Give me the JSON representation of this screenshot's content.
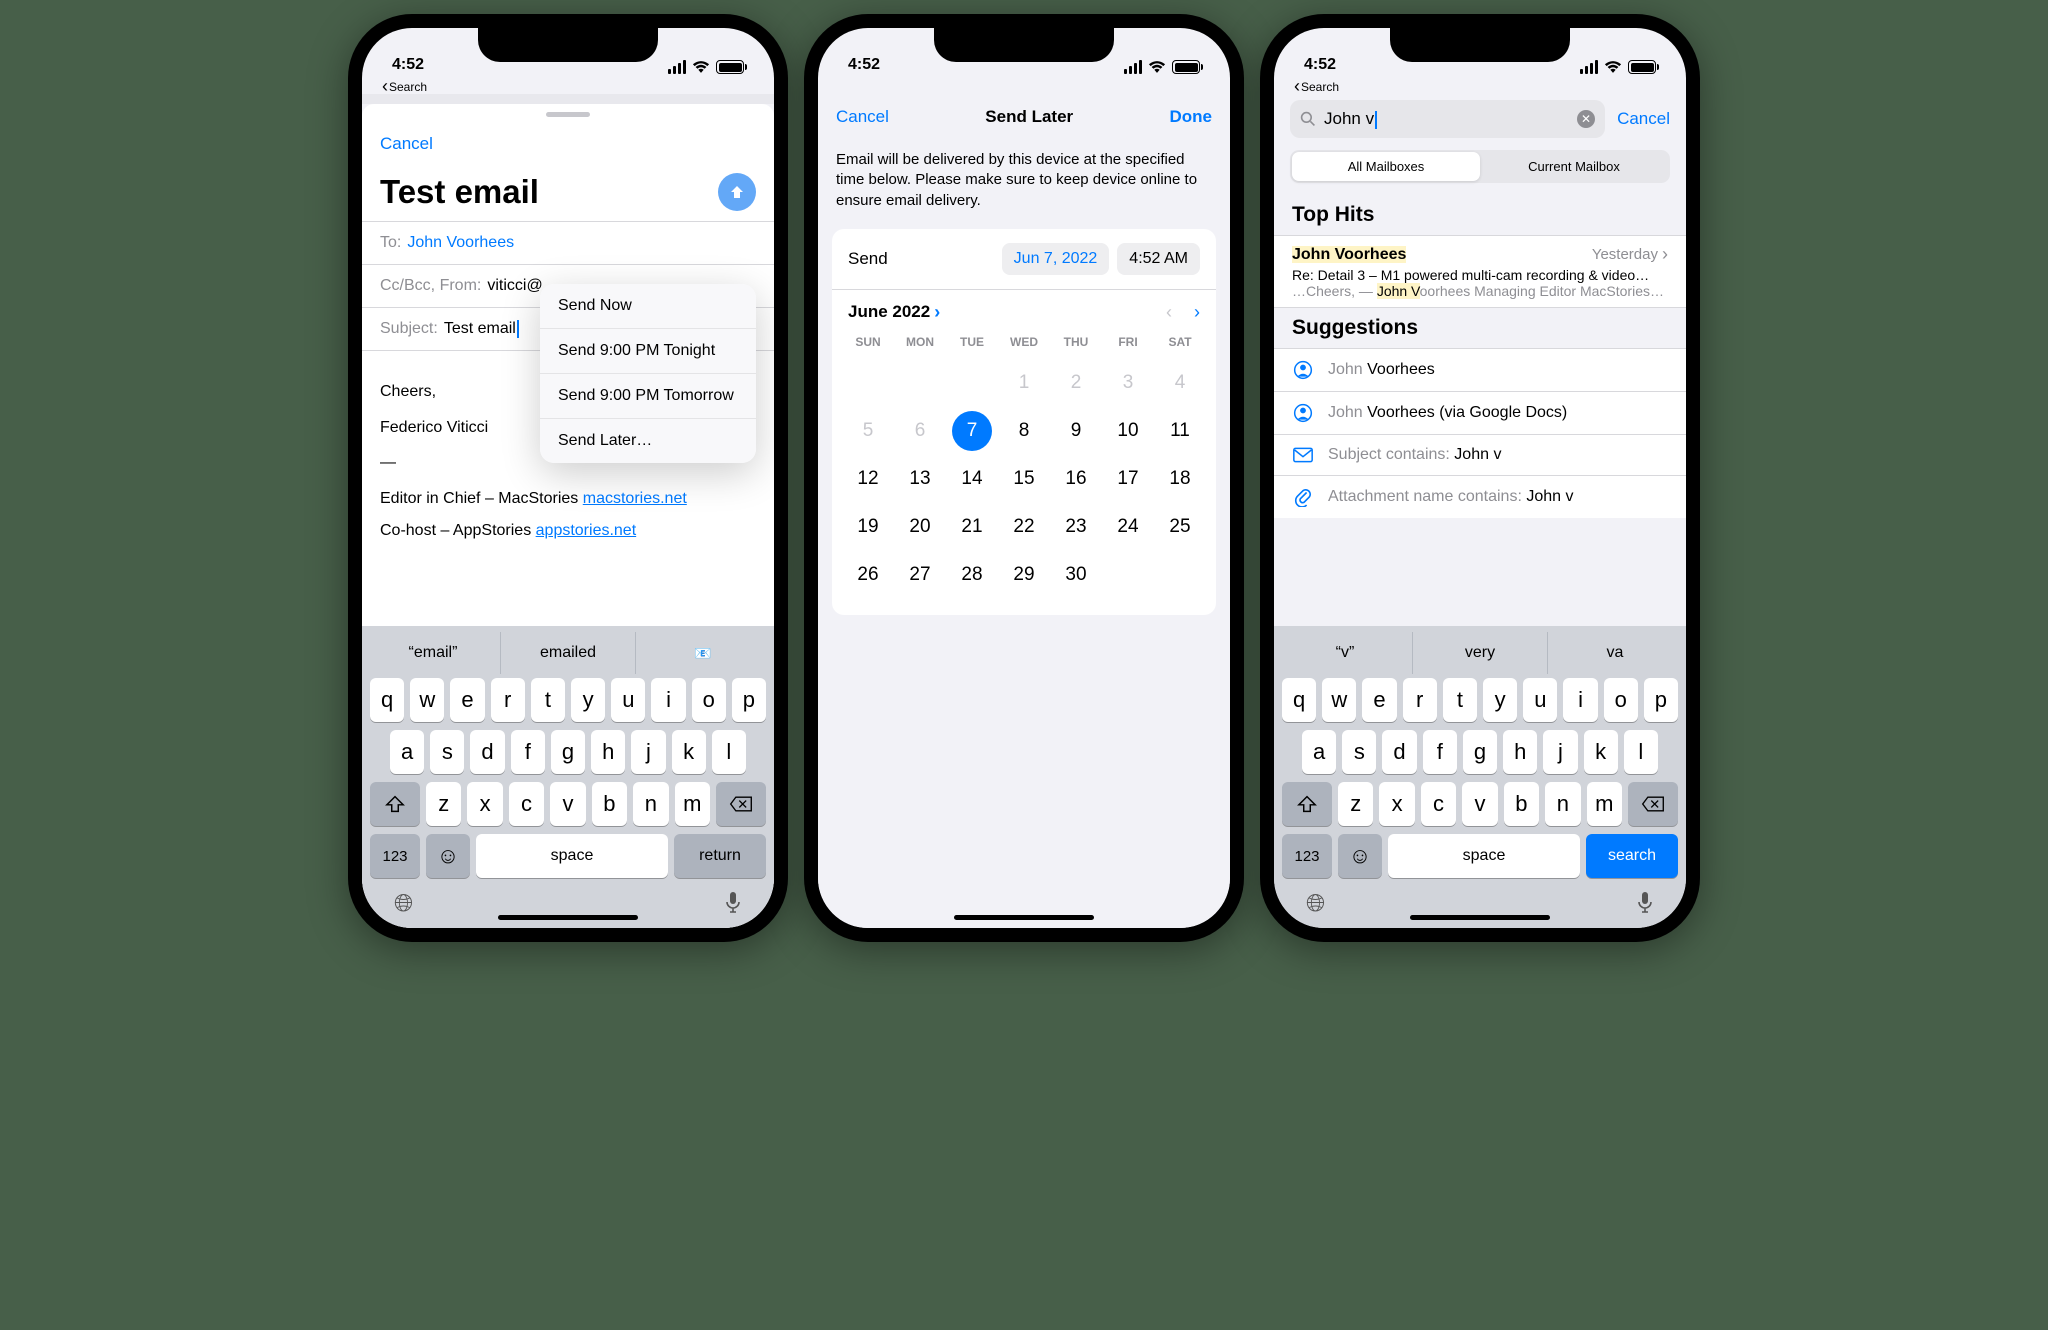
{
  "status": {
    "time": "4:52",
    "back_label": "Search"
  },
  "pane1": {
    "cancel": "Cancel",
    "title": "Test email",
    "to_label": "To:",
    "to_value": "John Voorhees",
    "cc_label": "Cc/Bcc, From:",
    "cc_value": "viticci@",
    "subject_label": "Subject:",
    "subject_value": "Test email",
    "menu": [
      "Send Now",
      "Send 9:00 PM Tonight",
      "Send 9:00 PM Tomorrow",
      "Send Later…"
    ],
    "body_cheers": "Cheers,",
    "body_name": "Federico Viticci",
    "body_dash": "—",
    "body_line1_pre": "Editor in Chief – MacStories ",
    "body_line1_link": "macstories.net",
    "body_line2_pre": "Co-host – AppStories ",
    "body_line2_link": "appstories.net",
    "sugg": [
      "“email”",
      "emailed",
      ""
    ],
    "return": "return",
    "space": "space",
    "num": "123"
  },
  "pane2": {
    "cancel": "Cancel",
    "title": "Send Later",
    "done": "Done",
    "desc": "Email will be delivered by this device at the specified time below. Please make sure to keep device online to ensure email delivery.",
    "send_label": "Send",
    "date_chip": "Jun 7, 2022",
    "time_chip": "4:52 AM",
    "month": "June 2022",
    "dow": [
      "SUN",
      "MON",
      "TUE",
      "WED",
      "THU",
      "FRI",
      "SAT"
    ],
    "days": [
      {
        "n": "",
        "t": "blank"
      },
      {
        "n": "",
        "t": "blank"
      },
      {
        "n": "",
        "t": "blank"
      },
      {
        "n": "1",
        "t": "dim"
      },
      {
        "n": "2",
        "t": "dim"
      },
      {
        "n": "3",
        "t": "dim"
      },
      {
        "n": "4",
        "t": "dim"
      },
      {
        "n": "5",
        "t": "dim"
      },
      {
        "n": "6",
        "t": "dim"
      },
      {
        "n": "7",
        "t": "sel"
      },
      {
        "n": "8",
        "t": ""
      },
      {
        "n": "9",
        "t": ""
      },
      {
        "n": "10",
        "t": ""
      },
      {
        "n": "11",
        "t": ""
      },
      {
        "n": "12",
        "t": ""
      },
      {
        "n": "13",
        "t": ""
      },
      {
        "n": "14",
        "t": ""
      },
      {
        "n": "15",
        "t": ""
      },
      {
        "n": "16",
        "t": ""
      },
      {
        "n": "17",
        "t": ""
      },
      {
        "n": "18",
        "t": ""
      },
      {
        "n": "19",
        "t": ""
      },
      {
        "n": "20",
        "t": ""
      },
      {
        "n": "21",
        "t": ""
      },
      {
        "n": "22",
        "t": ""
      },
      {
        "n": "23",
        "t": ""
      },
      {
        "n": "24",
        "t": ""
      },
      {
        "n": "25",
        "t": ""
      },
      {
        "n": "26",
        "t": ""
      },
      {
        "n": "27",
        "t": ""
      },
      {
        "n": "28",
        "t": ""
      },
      {
        "n": "29",
        "t": ""
      },
      {
        "n": "30",
        "t": ""
      }
    ]
  },
  "pane3": {
    "query": "John v",
    "cancel": "Cancel",
    "seg": [
      "All Mailboxes",
      "Current Mailbox"
    ],
    "top_hits": "Top Hits",
    "hit_name": "John Voorhees",
    "hit_when": "Yesterday",
    "hit_subject": "Re: Detail 3 – M1 powered multi-cam recording & video…",
    "hit_snip_pre": "…Cheers, — ",
    "hit_snip_hl": "John V",
    "hit_snip_post": "oorhees Managing Editor MacStories…",
    "suggestions": "Suggestions",
    "s1_pre": "John ",
    "s1_b": "Voorhees",
    "s2_pre": "John ",
    "s2_b": "Voorhees (via Google Docs)",
    "s3_pre": "Subject contains: ",
    "s3_b": "John v",
    "s4_pre": "Attachment name contains: ",
    "s4_b": "John v",
    "sugg": [
      "“v”",
      "very",
      "va"
    ],
    "search": "search"
  },
  "keys": {
    "r1": [
      "q",
      "w",
      "e",
      "r",
      "t",
      "y",
      "u",
      "i",
      "o",
      "p"
    ],
    "r2": [
      "a",
      "s",
      "d",
      "f",
      "g",
      "h",
      "j",
      "k",
      "l"
    ],
    "r3": [
      "z",
      "x",
      "c",
      "v",
      "b",
      "n",
      "m"
    ]
  }
}
